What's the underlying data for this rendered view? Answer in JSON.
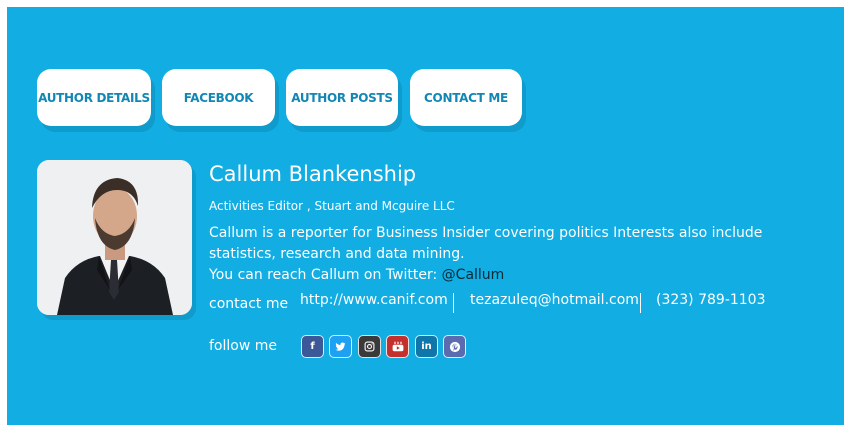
{
  "tabs": [
    {
      "label": "AUTHOR DETAILS"
    },
    {
      "label": "FACEBOOK"
    },
    {
      "label": "AUTHOR POSTS"
    },
    {
      "label": "CONTACT ME"
    }
  ],
  "author": {
    "name": "Callum Blankenship",
    "role": "Activities Editor , Stuart and Mcguire LLC",
    "bio_line1": "Callum is a reporter for Business Insider covering politics Interests also include statistics, research and data mining.",
    "bio_line2_prefix": "You can reach Callum on Twitter: ",
    "twitter_handle": "@Callum"
  },
  "contact": {
    "label": "contact me",
    "website": "http://www.canif.com",
    "email": "tezazuleq@hotmail.com",
    "phone": "(323) 789-1103"
  },
  "follow": {
    "label": "follow me",
    "icons": [
      {
        "name": "facebook-icon",
        "glyph": "f",
        "color": "#3b5998"
      },
      {
        "name": "twitter-icon",
        "glyph": "",
        "color": "#1da1f2"
      },
      {
        "name": "instagram-icon",
        "glyph": "",
        "color": "#3a3a3a"
      },
      {
        "name": "youtube-icon",
        "glyph": "",
        "color": "#c4302b"
      },
      {
        "name": "linkedin-icon",
        "glyph": "in",
        "color": "#0e76a8"
      },
      {
        "name": "pinterest-icon",
        "glyph": "P",
        "color": "#5b6bb0"
      }
    ]
  },
  "colors": {
    "panel": "#11ade3",
    "tab_text": "#1287b5",
    "link": "#0b2a38"
  }
}
